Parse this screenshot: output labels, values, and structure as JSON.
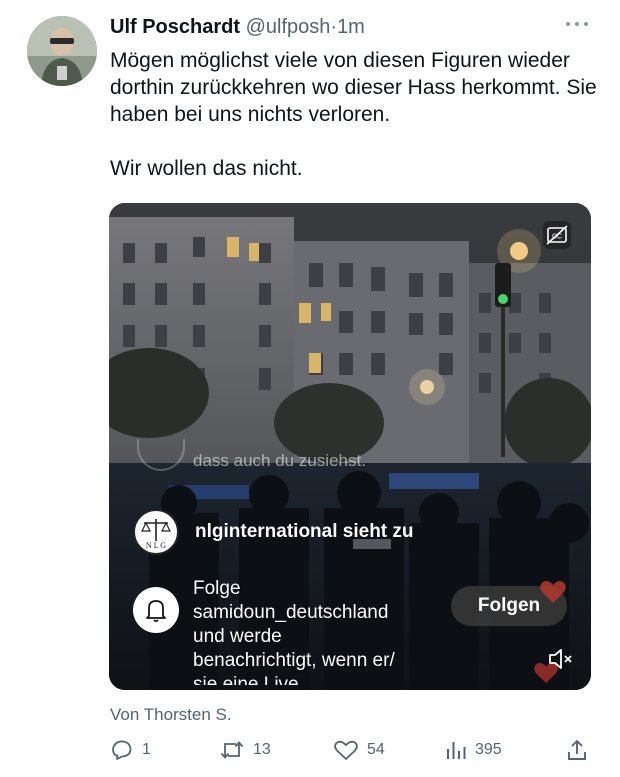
{
  "tweet": {
    "author_name": "Ulf Poschardt",
    "handle": "@ulfposh",
    "separator": "·",
    "time": "1m",
    "text_paragraph_1": "Mögen möglichst viele von diesen Figuren wieder dorthin zurückkehren wo dieser Hass herkommt. Sie haben bei uns nichts verloren.",
    "text_paragraph_2": "Wir wollen das nicht."
  },
  "media": {
    "caption_ghost": "dass auch du zusiehst.",
    "watch_label": "nlginternational sieht zu",
    "follow_lines": [
      "Folge",
      "samidoun_deutschland",
      "und werde",
      "benachrichtigt, wenn er/",
      "sie eine Live"
    ],
    "follow_button": "Folgen",
    "icons": [
      "closed-caption-icon",
      "bell-icon",
      "speaker-muted-icon",
      "heart-icon"
    ]
  },
  "source_label": "Von Thorsten S.",
  "actions": {
    "replies": "1",
    "retweets": "13",
    "likes": "54",
    "views": "395"
  },
  "colors": {
    "text": "#0f1419",
    "muted": "#536471",
    "follow_button_bg": "#3c3c3c"
  }
}
